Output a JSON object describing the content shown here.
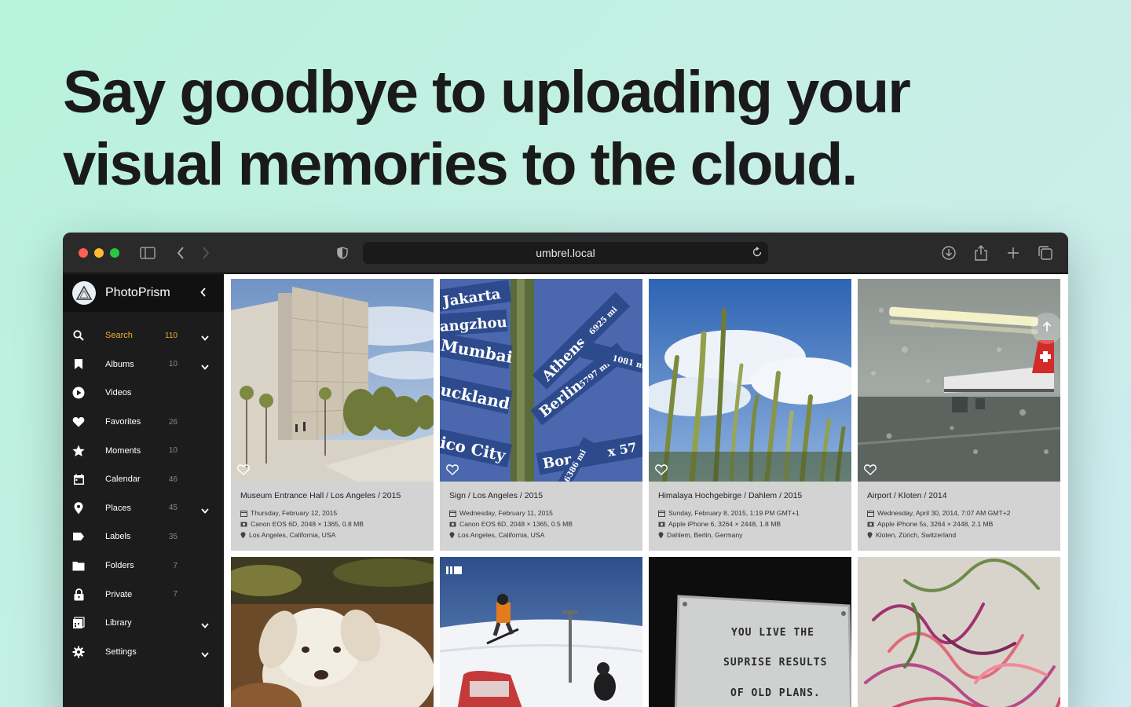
{
  "headline": {
    "line1": "Say goodbye to uploading your",
    "line2": "visual memories to the cloud."
  },
  "browser": {
    "url": "umbrel.local"
  },
  "sidebar": {
    "app_name": "PhotoPrism",
    "items": [
      {
        "label": "Search",
        "count": "110",
        "icon": "search-icon",
        "expandable": true,
        "active": true
      },
      {
        "label": "Albums",
        "count": "10",
        "icon": "bookmark-icon",
        "expandable": true
      },
      {
        "label": "Videos",
        "count": "",
        "icon": "play-icon"
      },
      {
        "label": "Favorites",
        "count": "26",
        "icon": "heart-icon"
      },
      {
        "label": "Moments",
        "count": "10",
        "icon": "star-icon"
      },
      {
        "label": "Calendar",
        "count": "46",
        "icon": "calendar-icon"
      },
      {
        "label": "Places",
        "count": "45",
        "icon": "location-pin-icon",
        "expandable": true
      },
      {
        "label": "Labels",
        "count": "35",
        "icon": "tag-icon"
      },
      {
        "label": "Folders",
        "count": "7",
        "icon": "folder-icon"
      },
      {
        "label": "Private",
        "count": "7",
        "icon": "lock-icon"
      },
      {
        "label": "Library",
        "count": "",
        "icon": "library-icon",
        "expandable": true
      },
      {
        "label": "Settings",
        "count": "",
        "icon": "gear-icon",
        "expandable": true
      }
    ]
  },
  "photos": [
    {
      "title": "Museum Entrance Hall / Los Angeles / 2015",
      "date": "Thursday, February 12, 2015",
      "camera": "Canon EOS 6D, 2048 × 1365, 0.8 MB",
      "location": "Los Angeles, California, USA"
    },
    {
      "title": "Sign / Los Angeles / 2015",
      "date": "Wednesday, February 11, 2015",
      "camera": "Canon EOS 6D, 2048 × 1365, 0.5 MB",
      "location": "Los Angeles, California, USA"
    },
    {
      "title": "Himalaya Hochgebirge / Dahlem / 2015",
      "date": "Sunday, February 8, 2015, 1:19 PM GMT+1",
      "camera": "Apple iPhone 6, 3264 × 2448, 1.8 MB",
      "location": "Dahlem, Berlin, Germany"
    },
    {
      "title": "Airport / Kloten / 2014",
      "date": "Wednesday, April 30, 2014, 7:07 AM GMT+2",
      "camera": "Apple iPhone 5s, 3264 × 2448, 2.1 MB",
      "location": "Kloten, Zürich, Switzerland"
    }
  ],
  "sign_words": {
    "jakarta": "Jakarta",
    "hangzhou": "angzhou",
    "mumbai": "Mumbai",
    "auckland": "uckland",
    "mexico": "ico City",
    "athens": "Athens",
    "berlin": "Berlin",
    "borders": "Bord",
    "d1": "6925 mi",
    "d2": "5797 mi",
    "d3": "1081 mi",
    "d4": "6386 mi",
    "x57": "x 57"
  },
  "plaque": {
    "line1": "YOU LIVE THE",
    "line2": "SUPRISE RESULTS",
    "line3": "OF OLD PLANS."
  },
  "colors": {
    "accent": "#f3ae2f",
    "sidebar_bg": "#1c1c1c",
    "card_bg": "#d3d3d3"
  }
}
